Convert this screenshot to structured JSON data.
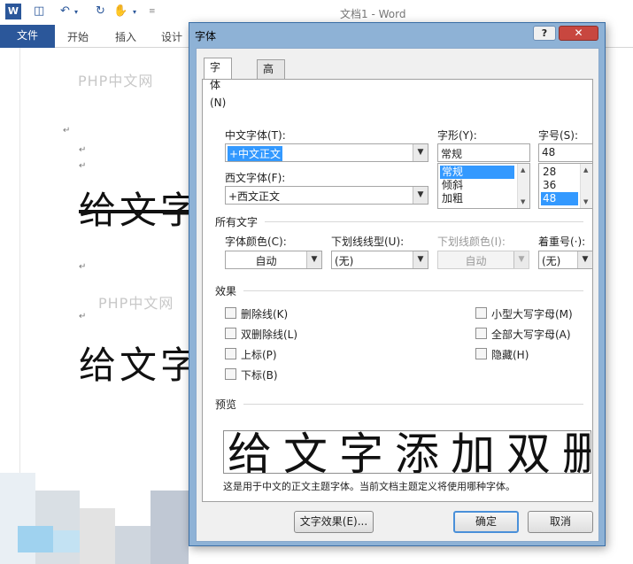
{
  "word": {
    "logo": "W",
    "window_title": "文档1 - Word",
    "ribbon_tabs": [
      "文件",
      "开始",
      "插入",
      "设计"
    ],
    "doc_lines": [
      "给文字",
      "给文字"
    ],
    "watermark": "PHP中文网"
  },
  "dialog": {
    "title": "字体",
    "help": "?",
    "close": "✕",
    "tabs": [
      "字体(N)",
      "高级(V)"
    ],
    "chinese_font_label": "中文字体(T):",
    "chinese_font_value": "+中文正文",
    "western_font_label": "西文字体(F):",
    "western_font_value": "+西文正文",
    "style_label": "字形(Y):",
    "style_value": "常规",
    "style_options": [
      "常规",
      "倾斜",
      "加粗"
    ],
    "size_label": "字号(S):",
    "size_value": "48",
    "size_options": [
      "28",
      "36",
      "48"
    ],
    "all_text_section": "所有文字",
    "font_color_label": "字体颜色(C):",
    "font_color_value": "自动",
    "underline_style_label": "下划线线型(U):",
    "underline_style_value": "(无)",
    "underline_color_label": "下划线颜色(I):",
    "underline_color_value": "自动",
    "emphasis_label": "着重号(·):",
    "emphasis_value": "(无)",
    "effects_section": "效果",
    "effects_left": [
      "删除线(K)",
      "双删除线(L)",
      "上标(P)",
      "下标(B)"
    ],
    "effects_right": [
      "小型大写字母(M)",
      "全部大写字母(A)",
      "隐藏(H)"
    ],
    "preview_section": "预览",
    "preview_text": "给文字添加双删",
    "preview_note": "这是用于中文的正文主题字体。当前文档主题定义将使用哪种字体。",
    "text_effects_button": "文字效果(E)...",
    "ok_button": "确定",
    "cancel_button": "取消"
  }
}
